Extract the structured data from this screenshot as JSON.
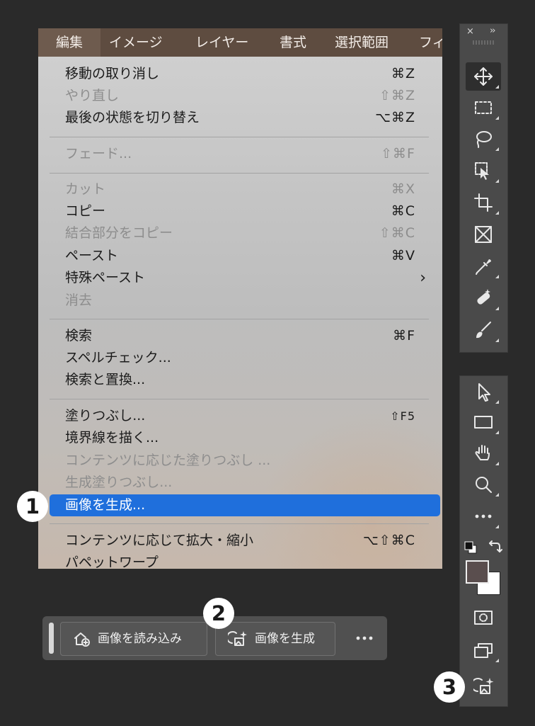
{
  "menubar": {
    "items": [
      "編集",
      "イメージ",
      "レイヤー",
      "書式",
      "選択範囲",
      "フィ"
    ]
  },
  "menu": {
    "items": [
      {
        "label": "移動の取り消し",
        "shortcut": "⌘Z"
      },
      {
        "label": "やり直し",
        "shortcut": "⇧⌘Z"
      },
      {
        "label": "最後の状態を切り替え",
        "shortcut": "⌥⌘Z"
      },
      {
        "label": "フェード...",
        "shortcut": "⇧⌘F"
      },
      {
        "label": "カット",
        "shortcut": "⌘X"
      },
      {
        "label": "コピー",
        "shortcut": "⌘C"
      },
      {
        "label": "結合部分をコピー",
        "shortcut": "⇧⌘C"
      },
      {
        "label": "ペースト",
        "shortcut": "⌘V"
      },
      {
        "label": "特殊ペースト",
        "shortcut": "›"
      },
      {
        "label": "消去",
        "shortcut": ""
      },
      {
        "label": "検索",
        "shortcut": "⌘F"
      },
      {
        "label": "スペルチェック...",
        "shortcut": ""
      },
      {
        "label": "検索と置換...",
        "shortcut": ""
      },
      {
        "label": "塗りつぶし...",
        "shortcut": "⇧F5"
      },
      {
        "label": "境界線を描く...",
        "shortcut": ""
      },
      {
        "label": "コンテンツに応じた塗りつぶし ...",
        "shortcut": ""
      },
      {
        "label": "生成塗りつぶし...",
        "shortcut": ""
      },
      {
        "label": "画像を生成...",
        "shortcut": ""
      },
      {
        "label": "コンテンツに応じて拡大・縮小",
        "shortcut": "⌥⇧⌘C"
      },
      {
        "label": "パペットワープ",
        "shortcut": ""
      }
    ]
  },
  "badges": [
    "1",
    "2",
    "3"
  ],
  "taskbar": {
    "import_label": "画像を読み込み",
    "generate_label": "画像を生成",
    "more_icon": "more-horizontal-icon"
  },
  "tool_panels": {
    "panel1_header_close": "×",
    "panel1_header_expand": "››",
    "tools1": [
      "move-icon",
      "rectangular-marquee-icon",
      "lasso-icon",
      "object-selection-icon",
      "crop-icon",
      "frame-icon",
      "eyedropper-icon",
      "spot-healing-icon",
      "brush-icon"
    ],
    "tools2": [
      "path-selection-icon",
      "rectangle-shape-icon",
      "hand-icon",
      "zoom-icon",
      "more-tools-icon",
      "default-colors-icon",
      "swap-colors-icon",
      "color-swatches-icon",
      "quick-mask-icon",
      "screen-mode-icon",
      "generate-image-icon"
    ],
    "foreground_color": "#5a4e4e",
    "background_color": "#ffffff"
  },
  "colors": {
    "highlight": "#1f6fdc",
    "menubar": "#5e4c40",
    "panel": "#4a4a4a"
  }
}
